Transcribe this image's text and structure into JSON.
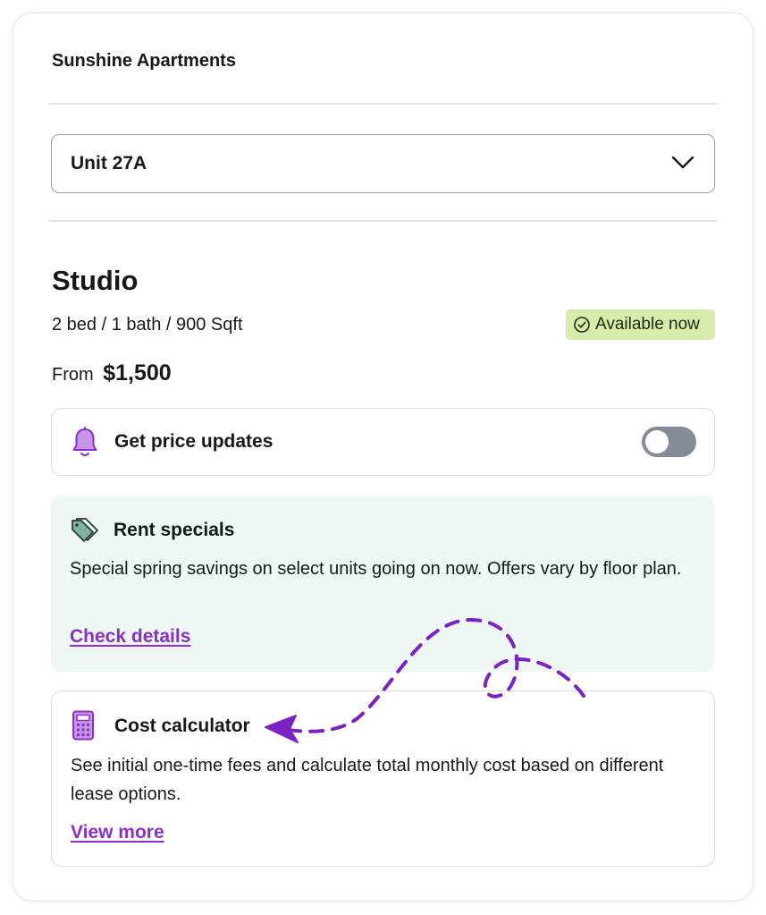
{
  "property": {
    "name": "Sunshine Apartments"
  },
  "unit_selector": {
    "selected": "Unit 27A",
    "icon": "chevron-down-icon"
  },
  "unit": {
    "title": "Studio",
    "specs": "2 bed / 1 bath / 900 Sqft",
    "availability": "Available now",
    "availability_icon": "check-circle-icon",
    "price_prefix": "From",
    "price": "$1,500"
  },
  "price_updates": {
    "label": "Get price updates",
    "icon": "bell-icon",
    "toggle_on": false
  },
  "rent_specials": {
    "title": "Rent specials",
    "icon": "tag-icon",
    "body": "Special spring savings on select units going on now. Offers vary by floor plan.",
    "link": "Check details"
  },
  "cost_calculator": {
    "title": "Cost calculator",
    "icon": "calculator-icon",
    "body": "See initial one-time fees and calculate total monthly cost based on different lease options.",
    "link": "View more"
  },
  "colors": {
    "accent": "#8b2fc9",
    "badge_bg": "#d7ecaa",
    "specials_bg": "#eef7f4",
    "toggle_off": "#858c96",
    "tag_icon": "#7fb2a4"
  }
}
